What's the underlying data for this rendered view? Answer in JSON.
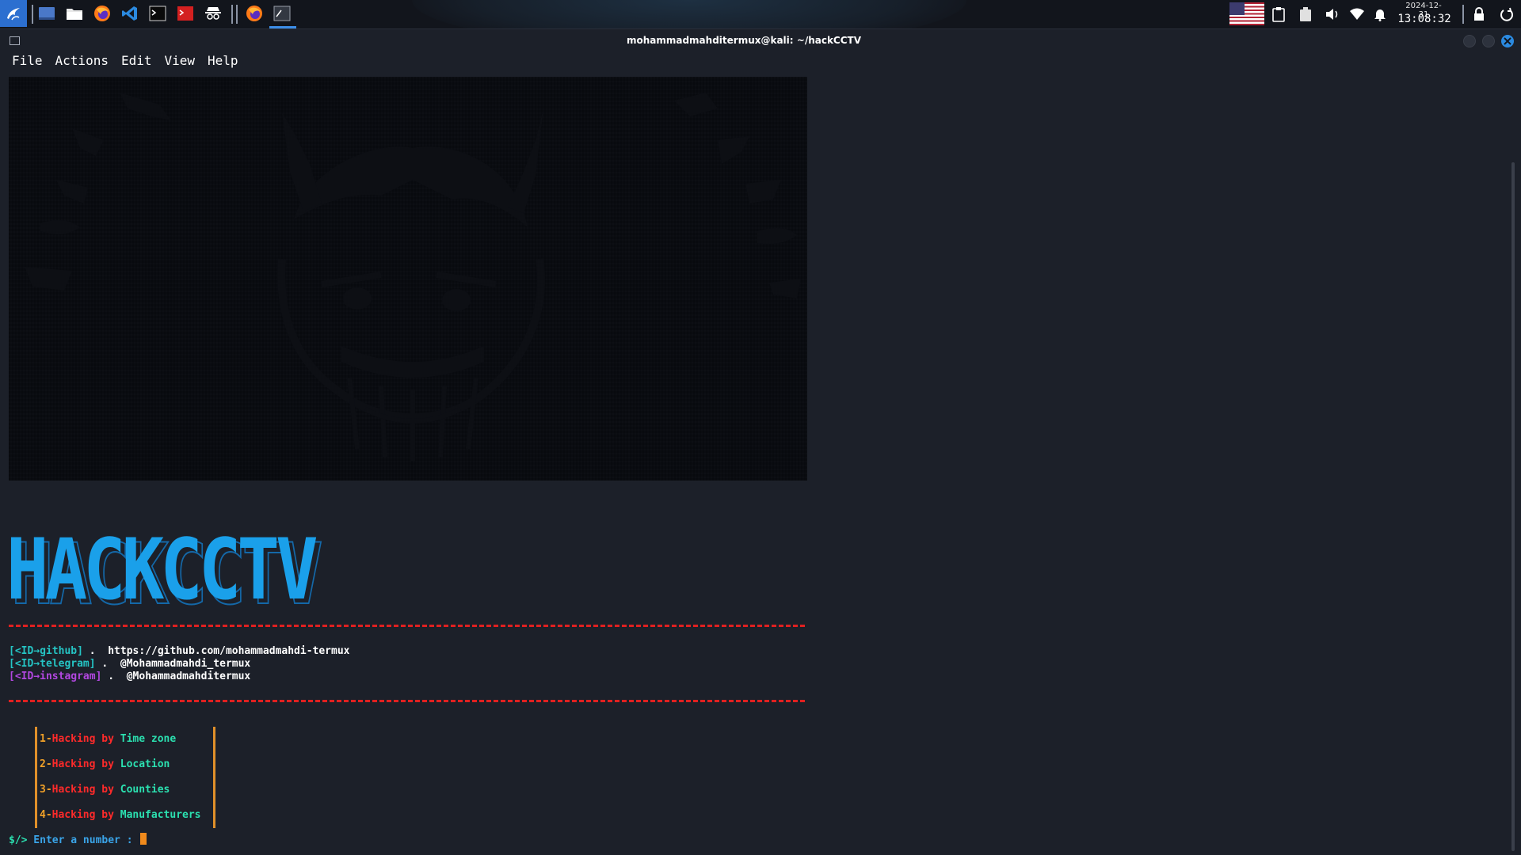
{
  "panel": {
    "launcher_icon": "kali-dragon-icon",
    "taskbar_icons": [
      "desktop-icon",
      "file-manager-icon",
      "firefox-icon",
      "vscode-icon",
      "terminal-icon",
      "red-terminal-icon",
      "incognito-icon",
      "firefox-icon",
      "terminal-window-icon"
    ],
    "tray_icons": [
      "us-flag-icon",
      "clipboard-icon",
      "battery-icon",
      "volume-icon",
      "network-icon",
      "bell-icon",
      "lock-icon",
      "power-icon"
    ],
    "clock_date": "2024-12-31",
    "clock_time": "13:08:32"
  },
  "window": {
    "title": "mohammadmahditermux@kali: ~/hackCCTV",
    "menu": [
      "File",
      "Actions",
      "Edit",
      "View",
      "Help"
    ]
  },
  "terminal": {
    "banner": "HACKCCTV",
    "links": [
      {
        "tag": "[<ID→github]",
        "sep": " .  ",
        "value": "https://github.com/mohammadmahdi-termux",
        "color": "#25c4c4"
      },
      {
        "tag": "[<ID→telegram]",
        "sep": " .  ",
        "value": "@Mohammadmahdi_termux",
        "color": "#25c4c4"
      },
      {
        "tag": "[<ID→instagram]",
        "sep": " .  ",
        "value": "@Mohammadmahditermux",
        "color": "#b247e0"
      }
    ],
    "options": [
      {
        "num": "1-",
        "prefix": "Hacking by ",
        "target": "Time zone"
      },
      {
        "num": "2-",
        "prefix": "Hacking by ",
        "target": "Location"
      },
      {
        "num": "3-",
        "prefix": "Hacking by ",
        "target": "Counties"
      },
      {
        "num": "4-",
        "prefix": "Hacking by ",
        "target": "Manufacturers"
      }
    ],
    "prompt_symbol": "$/>",
    "prompt_text": " Enter a number : "
  },
  "colors": {
    "accent_blue": "#1aa0ea",
    "dash_red": "#e02020",
    "menu_red": "#ff2a2a",
    "menu_green": "#2be0b0",
    "box_orange": "#e0902a"
  }
}
